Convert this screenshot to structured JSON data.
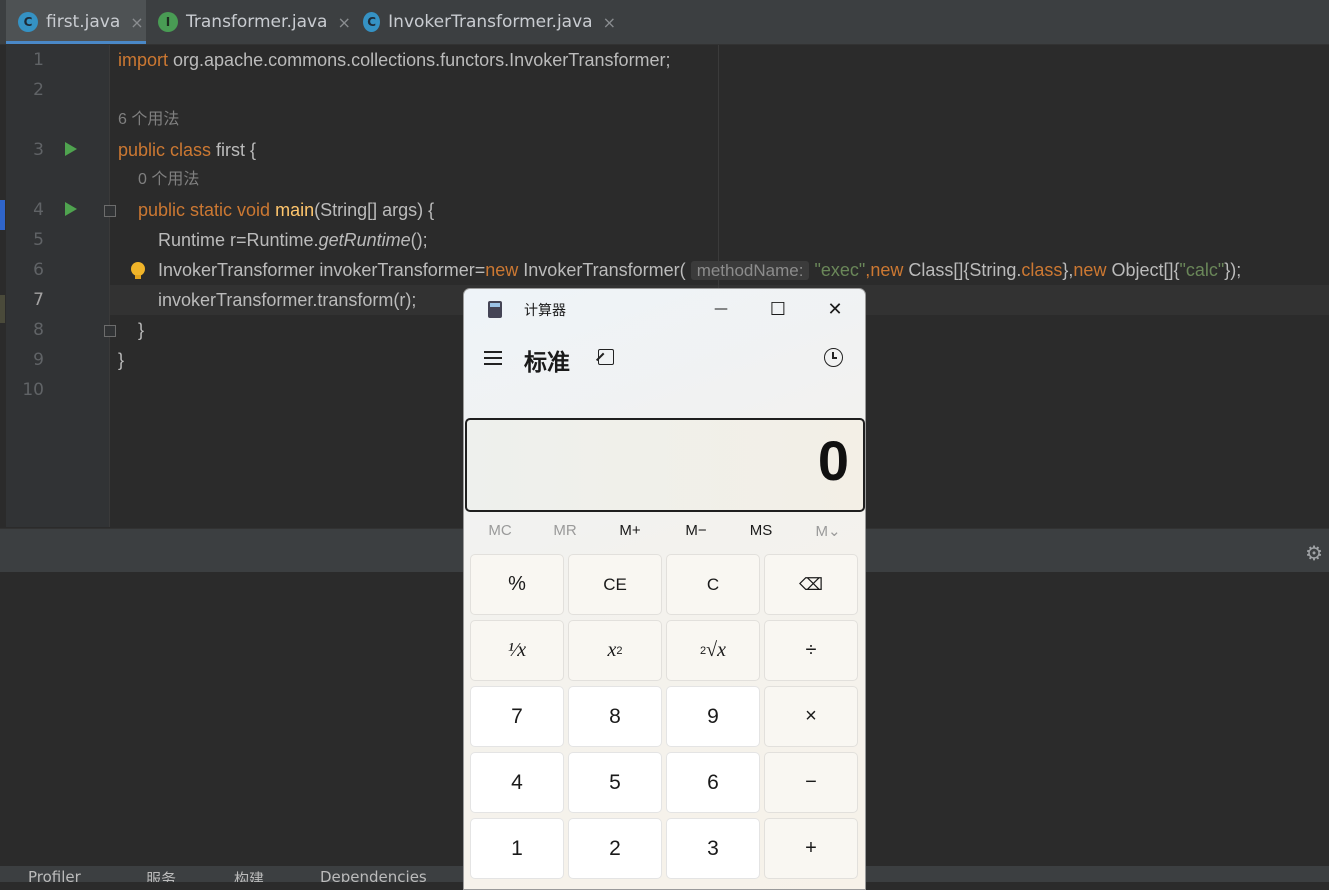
{
  "tabs": [
    {
      "icon_letter": "C",
      "icon_color": "#3592c4",
      "label": "first.java",
      "active": true
    },
    {
      "icon_letter": "I",
      "icon_color": "#499c54",
      "label": "Transformer.java",
      "active": false
    },
    {
      "icon_letter": "C",
      "icon_color": "#3592c4",
      "label": "InvokerTransformer.java",
      "active": false
    }
  ],
  "tab_close": "×",
  "gutter": {
    "line_numbers": [
      "1",
      "2",
      "3",
      "4",
      "5",
      "6",
      "7",
      "8",
      "9",
      "10"
    ],
    "current_line": "7"
  },
  "code": {
    "l1_kw": "import",
    "l1_rest": " org.apache.commons.collections.functors.InvokerTransformer;",
    "usages_class": "6 个用法",
    "l3_kw": "public class",
    "l3_rest": " first {",
    "usages_main": "0 个用法",
    "l4_kw": "public static void",
    "l4_fn": " main",
    "l4_rest": "(String[] args) {",
    "l5_a": "Runtime r=Runtime.",
    "l5_b": "getRuntime",
    "l5_c": "();",
    "l6_a": "InvokerTransformer invokerTransformer=",
    "l6_new1": "new",
    "l6_b": " InvokerTransformer(",
    "l6_hint": "methodName:",
    "l6_s1": "\"exec\"",
    "l6_c": ",",
    "l6_new2": "new",
    "l6_d": " Class[]{String.",
    "l6_class": "class",
    "l6_e": "},",
    "l6_new3": "new",
    "l6_f": " Object[]{",
    "l6_s2": "\"calc\"",
    "l6_g": "});",
    "l7": "invokerTransformer.transform(r);",
    "l8": "}",
    "l9": "}"
  },
  "bottom_tools": [
    "Profiler",
    "服务",
    "构建",
    "Dependencies"
  ],
  "calculator": {
    "title": "计算器",
    "mode": "标准",
    "display": "0",
    "memory": [
      {
        "label": "MC",
        "enabled": false
      },
      {
        "label": "MR",
        "enabled": false
      },
      {
        "label": "M+",
        "enabled": true
      },
      {
        "label": "M−",
        "enabled": true
      },
      {
        "label": "MS",
        "enabled": true
      },
      {
        "label": "M⌄",
        "enabled": false
      }
    ],
    "keys": {
      "percent": "%",
      "ce": "CE",
      "c": "C",
      "backspace": "⌫",
      "reciprocal": "¹⁄x",
      "square": "x",
      "square_exp": "2",
      "sqrt_idx": "2",
      "sqrt": "√x",
      "divide": "÷",
      "seven": "7",
      "eight": "8",
      "nine": "9",
      "multiply": "×",
      "four": "4",
      "five": "5",
      "six": "6",
      "minus": "−",
      "one": "1",
      "two": "2",
      "three": "3",
      "plus": "+"
    },
    "win": {
      "minimize": "—",
      "maximize": "☐",
      "close": "✕"
    }
  }
}
